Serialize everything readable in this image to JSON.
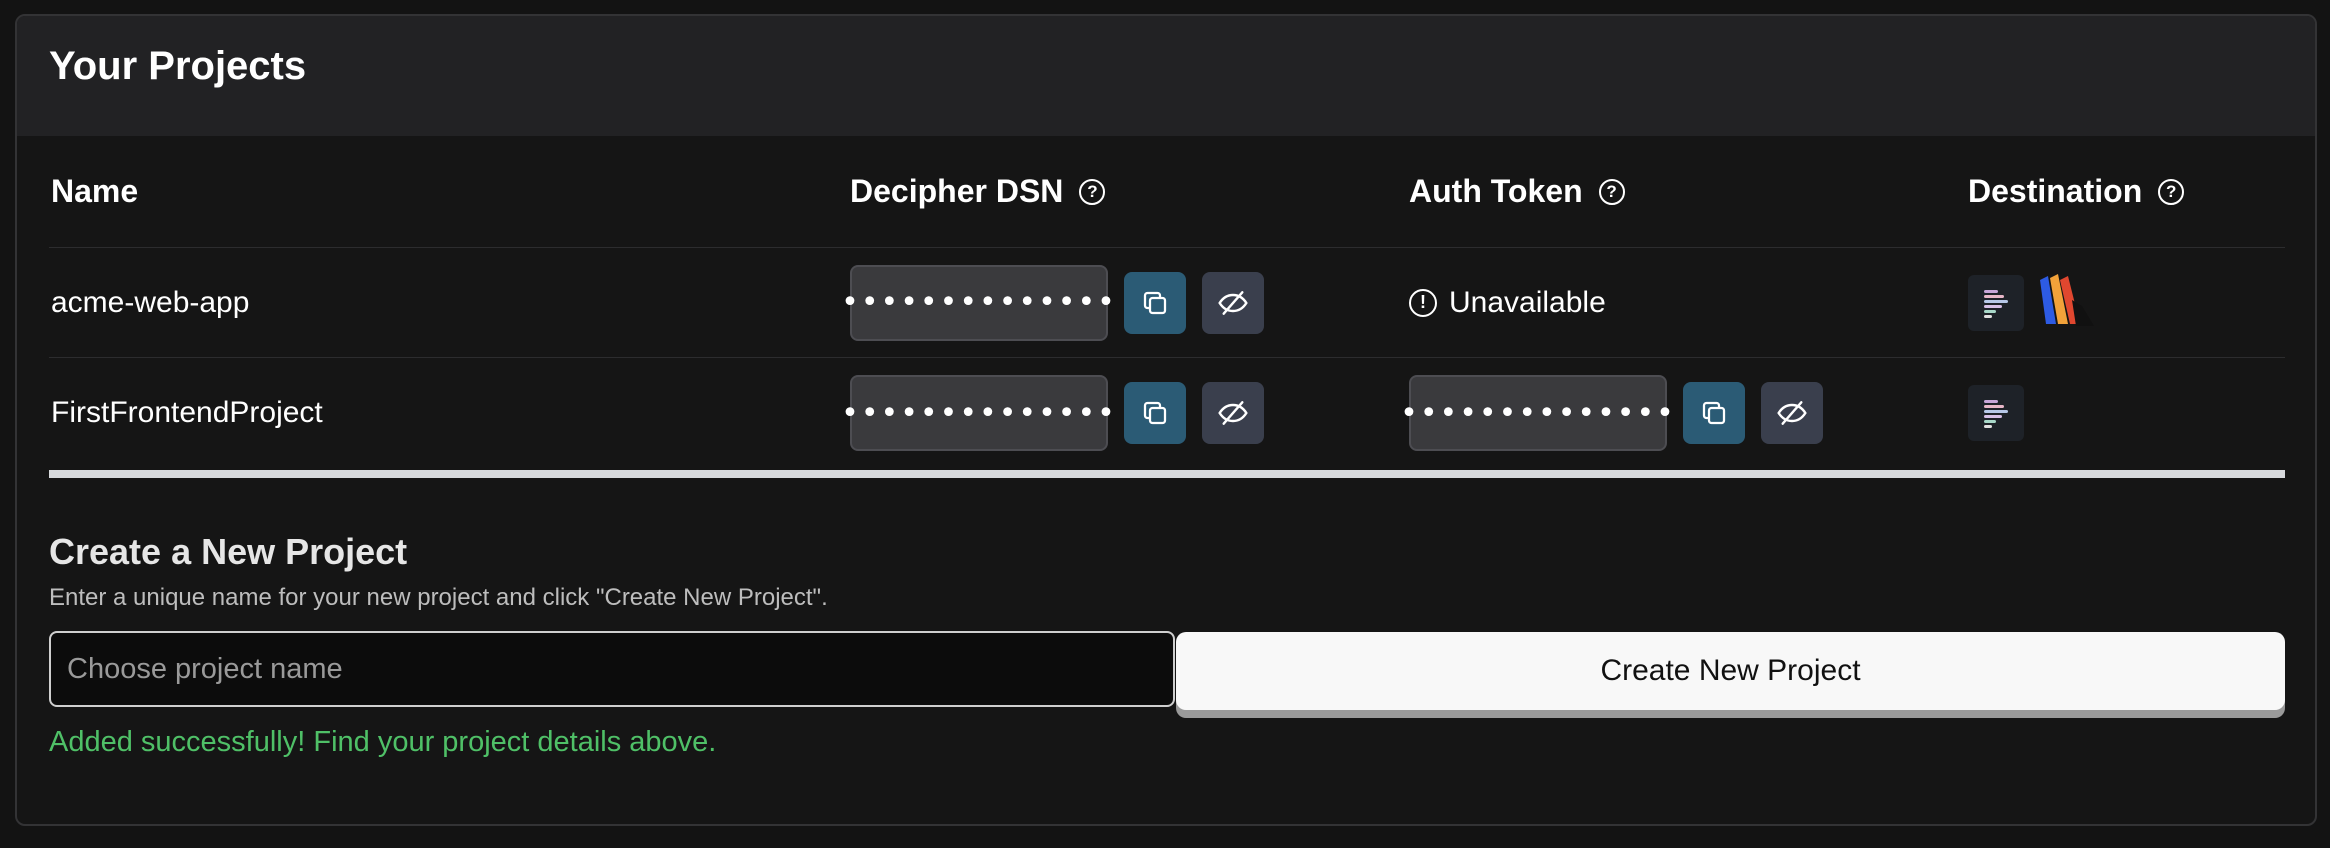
{
  "header": {
    "title": "Your Projects"
  },
  "table": {
    "columns": {
      "name": "Name",
      "dsn": "Decipher DSN",
      "auth": "Auth Token",
      "destination": "Destination"
    },
    "help_glyph": "?",
    "rows": [
      {
        "name": "acme-web-app",
        "dsn_masked": "••••••••••••••",
        "auth_status": "Unavailable",
        "auth_status_glyph": "!",
        "destinations": [
          "decipher-logo-icon",
          "striped-logo-icon"
        ]
      },
      {
        "name": "FirstFrontendProject",
        "dsn_masked": "••••••••••••••",
        "auth_masked": "••••••••••••••",
        "destinations": [
          "decipher-logo-icon"
        ]
      }
    ]
  },
  "create": {
    "title": "Create a New Project",
    "description": "Enter a unique name for your new project and click \"Create New Project\".",
    "input_placeholder": "Choose project name",
    "input_value": "",
    "button_label": "Create New Project",
    "success_message": "Added successfully! Find your project details above."
  },
  "colors": {
    "background": "#131313",
    "header_bg": "#222224",
    "copy_button": "#2b5b75",
    "eye_button": "#3a3f4d",
    "success": "#4fc067"
  }
}
